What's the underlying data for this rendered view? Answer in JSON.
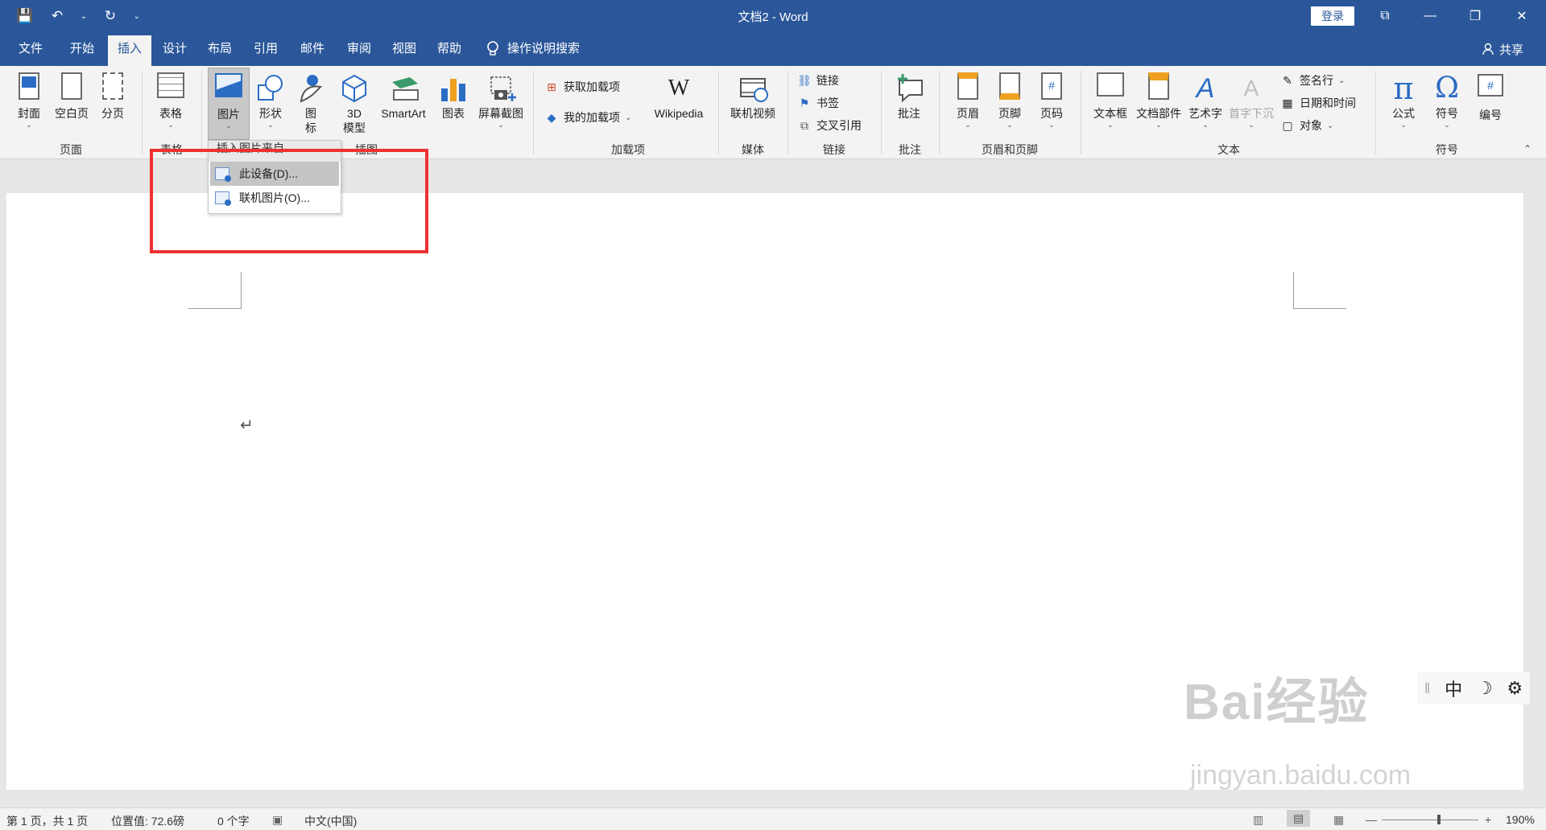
{
  "titlebar": {
    "title": "文档2  -  Word",
    "login": "登录",
    "qat": {
      "save": "💾",
      "undo": "↶",
      "undo_more": "⌄",
      "redo": "↻",
      "customize": "⌄"
    },
    "controls": {
      "ribbon_options": "⧉",
      "minimize": "—",
      "restore": "❐",
      "close": "✕"
    }
  },
  "tabs": [
    "文件",
    "开始",
    "插入",
    "设计",
    "布局",
    "引用",
    "邮件",
    "审阅",
    "视图",
    "帮助"
  ],
  "active_tab": "插入",
  "tellme": "操作说明搜索",
  "share": "共享",
  "ribbon": {
    "groups": {
      "pages": "页面",
      "tables": "表格",
      "illustrations": "插图",
      "addins": "加载项",
      "media": "媒体",
      "links": "链接",
      "comments": "批注",
      "header_footer": "页眉和页脚",
      "text": "文本",
      "symbols": "符号"
    },
    "buttons": {
      "cover": "封面",
      "blank": "空白页",
      "pagebreak": "分页",
      "table": "表格",
      "pictures": "图片",
      "shapes": "形状",
      "icons_1": "图",
      "icons_2": "标",
      "model_1": "3D",
      "model_2": "模型",
      "smartart": "SmartArt",
      "chart": "图表",
      "screenshot": "屏幕截图",
      "get_addins": "获取加载项",
      "my_addins": "我的加载项",
      "wikipedia": "Wikipedia",
      "wiki_glyph": "W",
      "online_video": "联机视频",
      "link": "链接",
      "bookmark": "书签",
      "crossref": "交叉引用",
      "comment": "批注",
      "header": "页眉",
      "footer": "页脚",
      "pagenum": "页码",
      "textbox": "文本框",
      "quickparts": "文档部件",
      "wordart": "艺术字",
      "dropcap": "首字下沉",
      "signature": "签名行",
      "datetime": "日期和时间",
      "object": "对象",
      "equation": "公式",
      "symbol": "符号",
      "numbering": "编号",
      "equation_glyph": "π",
      "symbol_glyph": "Ω",
      "numbering_glyph": "#",
      "wordart_glyph": "A",
      "dropcap_glyph": "A"
    }
  },
  "dropdown": {
    "header": "插入图片来自",
    "items": [
      "此设备(D)...",
      "联机图片(O)..."
    ]
  },
  "ime": {
    "mode": "中",
    "moon": "☽",
    "settings": "⚙"
  },
  "watermark": {
    "main": "Bai经验",
    "sub": "jingyan.baidu.com"
  },
  "status": {
    "page": "第 1 页，共 1 页",
    "position": "位置值: 72.6磅",
    "words": "0 个字",
    "language": "中文(中国)",
    "zoom": "190%",
    "zoom_minus": "—",
    "zoom_plus": "+"
  }
}
